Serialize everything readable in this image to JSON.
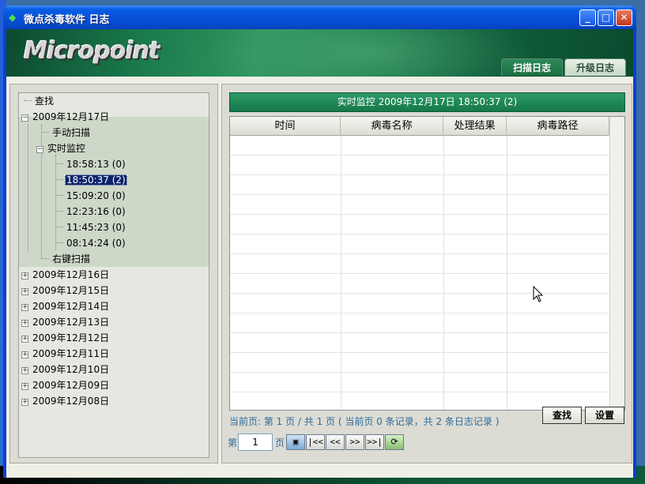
{
  "window": {
    "title": "微点杀毒软件  日志"
  },
  "banner": {
    "logo": "Micropoint",
    "tabs": [
      {
        "label": "扫描日志"
      },
      {
        "label": "升级日志"
      }
    ]
  },
  "tree": {
    "search_label": "查找",
    "expanded_date": "2009年12月17日",
    "manual_scan": "手动扫描",
    "realtime": "实时监控",
    "realtime_entries": [
      "18:58:13 (0)",
      "18:50:37 (2)",
      "15:09:20 (0)",
      "12:23:16 (0)",
      "11:45:23 (0)",
      "08:14:24 (0)"
    ],
    "right_click_scan": "右键扫描",
    "collapsed_dates": [
      "2009年12月16日",
      "2009年12月15日",
      "2009年12月14日",
      "2009年12月13日",
      "2009年12月12日",
      "2009年12月11日",
      "2009年12月10日",
      "2009年12月09日",
      "2009年12月08日"
    ],
    "expand_symbol": "+",
    "collapse_symbol": "−"
  },
  "main": {
    "status_title": "实时监控 2009年12月17日 18:50:37 (2)",
    "columns": [
      "时间",
      "病毒名称",
      "处理结果",
      "病毒路径"
    ],
    "rows": [],
    "page_info": "当前页: 第 1 页 / 共 1 页 ( 当前页 0 条记录，共 2 条日志记录 )",
    "pager": {
      "label_before": "第",
      "page_value": "1",
      "label_after": "页",
      "first": "|<<",
      "prev": "<<",
      "next": ">>",
      "last": ">>|"
    },
    "search_button": "查找",
    "settings_button": "设置"
  },
  "colors": {
    "accent_green": "#1f8a56",
    "selection": "#0a246a",
    "titlebar": "#0752d8"
  }
}
